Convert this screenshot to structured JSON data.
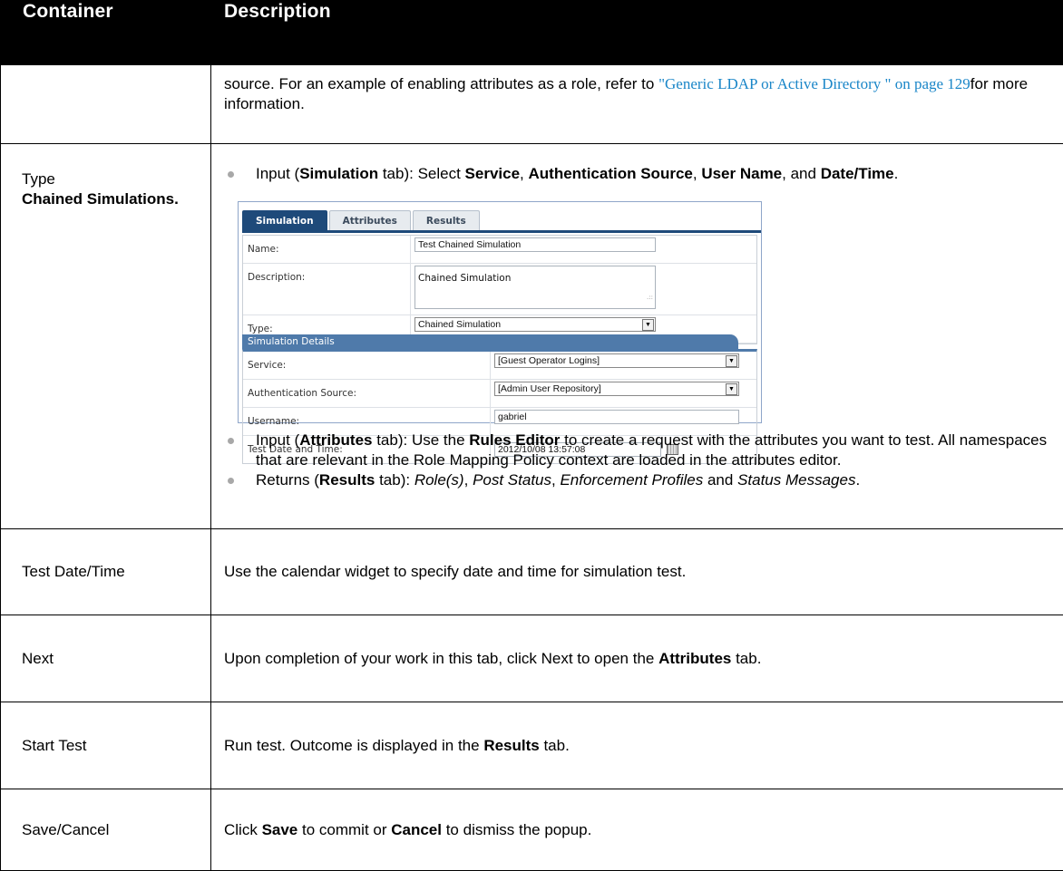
{
  "table": {
    "headers": [
      "Container",
      "Description"
    ],
    "row_source": {
      "text_before": "source. For an example of enabling attributes as a role, refer to ",
      "link": "\"Generic LDAP or Active Directory \" on page 129",
      "text_after": "for more information."
    },
    "row_type": {
      "label": "Type",
      "label_bold": "Chained Simulations.",
      "bullet1": {
        "t1": "Input (",
        "b1": "Simulation",
        "t2": " tab): Select ",
        "b2": "Service",
        "t3": ", ",
        "b3": "Authentication Source",
        "t4": ", ",
        "b4": "User Name",
        "t5": ", and ",
        "b5": "Date/Time",
        "t6": "."
      },
      "bullet2": {
        "t1": "Input (",
        "b1": "Attributes",
        "t2": " tab): Use the ",
        "b2": "Rules Editor",
        "t3": " to create a request with the attributes you want to test. All namespaces that are relevant in the Role Mapping Policy context are loaded in the attributes editor."
      },
      "bullet3": {
        "t1": "Returns (",
        "b1": "Results",
        "t2": " tab): ",
        "i1": "Role(s)",
        "t3": ", ",
        "i2": "Post Status",
        "t4": ", ",
        "i3": "Enforcement Profiles",
        "t5": " and ",
        "i4": "Status Messages",
        "t6": "."
      }
    },
    "row_test_date": {
      "label": "Test Date/Time",
      "desc": "Use the calendar widget to specify date and time for simulation test."
    },
    "row_next": {
      "label": "Next",
      "t1": "Upon completion of your work in this tab, click Next to open the ",
      "b1": "Attributes",
      "t2": " tab."
    },
    "row_start": {
      "label": "Start Test",
      "t1": "Run test. Outcome is displayed in the ",
      "b1": "Results",
      "t2": " tab."
    },
    "row_save": {
      "label": "Save/Cancel",
      "t1": "Click ",
      "b1": "Save",
      "t2": " to commit or ",
      "b2": "Cancel",
      "t3": " to dismiss the popup."
    }
  },
  "screenshot": {
    "tabs": [
      "Simulation",
      "Attributes",
      "Results"
    ],
    "active_tab": "Simulation",
    "name_label": "Name:",
    "name_value": "Test Chained Simulation",
    "description_label": "Description:",
    "description_value": "Chained Simulation",
    "type_label": "Type:",
    "type_value": "Chained Simulation",
    "details_header": "Simulation Details",
    "service_label": "Service:",
    "service_value": "[Guest Operator Logins]",
    "auth_label": "Authentication Source:",
    "auth_value": "[Admin User Repository]",
    "username_label": "Username:",
    "username_value": "gabriel",
    "datetime_label": "Test Date and Time:",
    "datetime_value": "2012/10/08 13:57:08"
  }
}
